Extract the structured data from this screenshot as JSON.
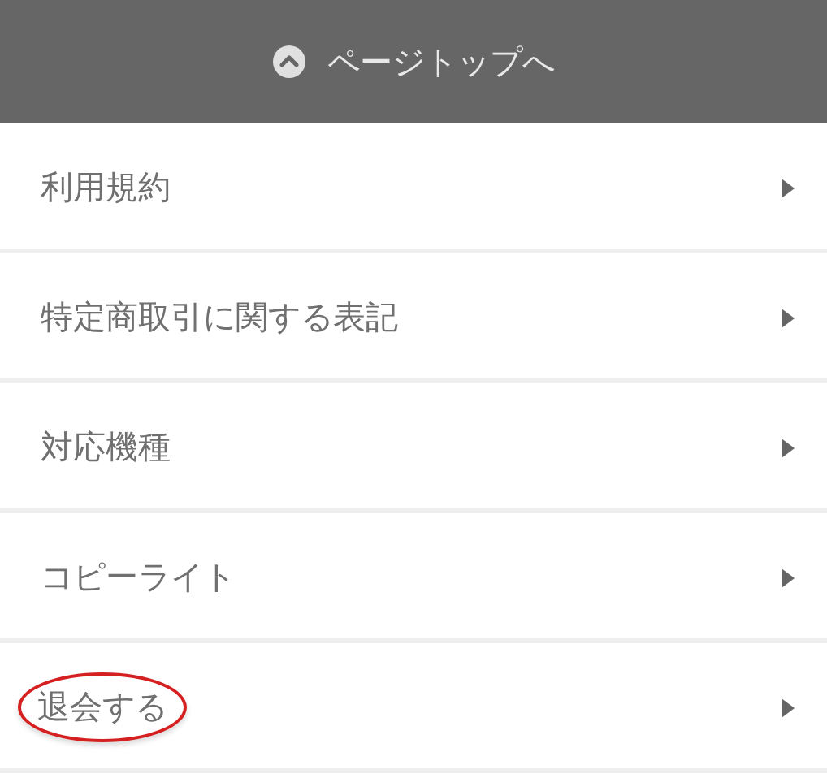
{
  "page_top_button": {
    "label": "ページトップへ"
  },
  "menu_items": [
    {
      "label": "利用規約",
      "circled": false
    },
    {
      "label": "特定商取引に関する表記",
      "circled": false
    },
    {
      "label": "対応機種",
      "circled": false
    },
    {
      "label": "コピーライト",
      "circled": false
    },
    {
      "label": "退会する",
      "circled": true
    }
  ]
}
